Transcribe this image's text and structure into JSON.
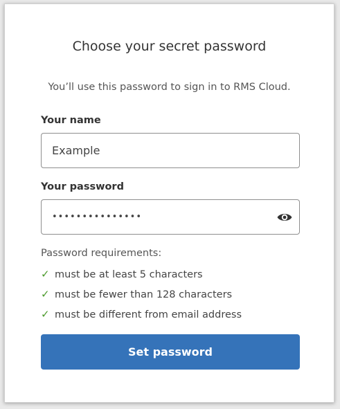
{
  "form": {
    "title": "Choose your secret password",
    "subtitle": "You’ll use this password to sign in to RMS Cloud.",
    "name_label": "Your name",
    "name_value": "Example",
    "password_label": "Your password",
    "password_value": "•••••••••••••••",
    "password_visibility_icon": "eye-icon",
    "requirements_heading": "Password requirements:",
    "requirements": [
      {
        "icon": "check-icon",
        "text": "must be at least 5 characters"
      },
      {
        "icon": "check-icon",
        "text": "must be fewer than 128 characters"
      },
      {
        "icon": "check-icon",
        "text": "must be different from email address"
      }
    ],
    "submit_label": "Set password"
  },
  "colors": {
    "primary_button": "#3573b9",
    "check": "#4b9a2b"
  }
}
